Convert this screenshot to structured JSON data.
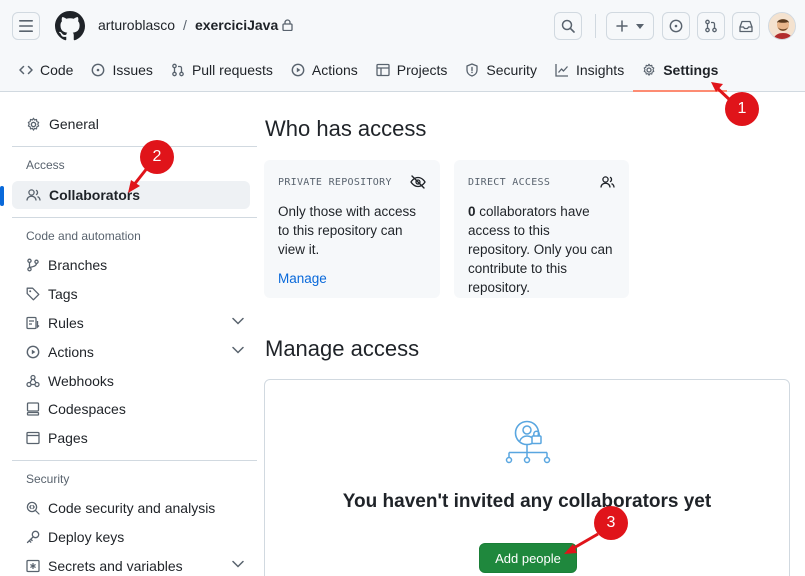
{
  "header": {
    "owner": "arturoblasco",
    "separator": "/",
    "repo": "exerciciJava"
  },
  "tabs": [
    {
      "label": "Code",
      "icon": "code-icon"
    },
    {
      "label": "Issues",
      "icon": "issue-icon"
    },
    {
      "label": "Pull requests",
      "icon": "pull-request-icon"
    },
    {
      "label": "Actions",
      "icon": "play-icon"
    },
    {
      "label": "Projects",
      "icon": "table-icon"
    },
    {
      "label": "Security",
      "icon": "shield-icon"
    },
    {
      "label": "Insights",
      "icon": "graph-icon"
    },
    {
      "label": "Settings",
      "icon": "gear-icon",
      "active": true
    }
  ],
  "sidebar": {
    "general": "General",
    "access_heading": "Access",
    "collaborators": "Collaborators",
    "code_heading": "Code and automation",
    "code_items": [
      "Branches",
      "Tags",
      "Rules",
      "Actions",
      "Webhooks",
      "Codespaces",
      "Pages"
    ],
    "security_heading": "Security",
    "security_items": [
      "Code security and analysis",
      "Deploy keys",
      "Secrets and variables"
    ]
  },
  "main": {
    "who_title": "Who has access",
    "private_card": {
      "label": "PRIVATE REPOSITORY",
      "body": "Only those with access to this repository can view it.",
      "link": "Manage"
    },
    "direct_card": {
      "label": "DIRECT ACCESS",
      "count": "0",
      "body_rest": " collaborators have access to this repository. Only you can contribute to this repository."
    },
    "manage_title": "Manage access",
    "empty_title": "You haven't invited any collaborators yet",
    "add_button": "Add people"
  },
  "annotations": [
    "1",
    "2",
    "3"
  ],
  "colors": {
    "accent": "#0969da",
    "primary_button": "#1f883d",
    "annotation": "#e0141a",
    "active_tab_underline": "#fd8c73"
  }
}
